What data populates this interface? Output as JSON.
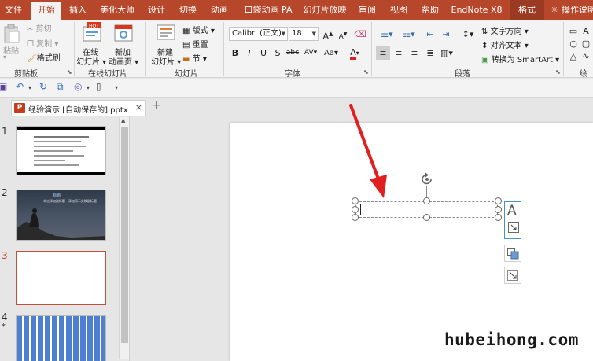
{
  "tabs": [
    "文件",
    "开始",
    "插入",
    "美化大师",
    "设计",
    "切换",
    "动画",
    "口袋动画 PA",
    "幻灯片放映",
    "审阅",
    "视图",
    "帮助",
    "EndNote X8",
    "格式"
  ],
  "tell_me": "操作说明",
  "colors": {
    "brand": "#b7472a",
    "accent_arrow": "#e02020",
    "selected_border": "#c0503a"
  },
  "ribbon": {
    "clipboard": {
      "paste": "粘贴",
      "cut": "剪切",
      "copy": "复制",
      "format_painter": "格式刷",
      "label": "剪贴板"
    },
    "online_slides": {
      "btn1_l1": "在线",
      "btn1_l2": "幻灯片",
      "btn2_l1": "新加",
      "btn2_l2": "动画页",
      "label": "在线幻灯片"
    },
    "slides": {
      "new_l1": "新建",
      "new_l2": "幻灯片",
      "layout": "版式",
      "reset": "重置",
      "section": "节",
      "label": "幻灯片"
    },
    "font": {
      "name": "Calibri (正文)",
      "size": "18",
      "bold": "B",
      "italic": "I",
      "underline": "U",
      "strike": "S",
      "spacing": "abc",
      "char_spacing": "AV",
      "case": "Aa",
      "color": "A",
      "grow": "A",
      "shrink": "A",
      "label": "字体"
    },
    "paragraph": {
      "text_direction": "文字方向",
      "align_text": "对齐文本",
      "smartart": "转换为 SmartArt",
      "label": "段落"
    },
    "drawing": {
      "label": "绘"
    }
  },
  "document": {
    "tab_title": "经验演示 [自动保存的].pptx",
    "close": "×",
    "new_tab": "+"
  },
  "thumbnails": [
    {
      "number": "1",
      "kind": "text-dark"
    },
    {
      "number": "2",
      "kind": "photo",
      "title": "标题",
      "subtitle": "单击添加副标题 · 添加演示文稿副标题"
    },
    {
      "number": "3",
      "kind": "blank",
      "selected": true
    },
    {
      "number": "4",
      "kind": "stripes",
      "marker": "*"
    }
  ],
  "side_tools": {
    "text_icon": "A"
  },
  "watermark": "hubeihong.com"
}
